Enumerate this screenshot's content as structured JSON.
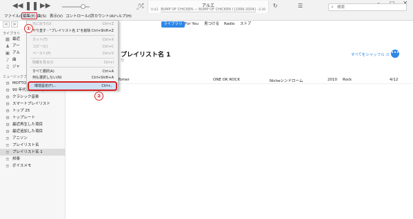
{
  "player": {
    "prev_icon": "rewind-icon",
    "pause_icon": "pause-icon",
    "next_icon": "fast-forward-icon",
    "shuffle_icon": "shuffle-icon",
    "repeat_icon": "repeat-icon"
  },
  "now_playing": {
    "title": "アルエ",
    "subtitle": "BUMP OF CHICKEN — BUMP OF CHICKEN I [1999-2004]",
    "elapsed": "0:43",
    "remaining": "-3:39"
  },
  "window_controls": {
    "list_icon": "list-icon",
    "minimize": "–",
    "maximize": "□",
    "close": "×"
  },
  "search": {
    "placeholder": "検索"
  },
  "menubar": {
    "items": [
      "ファイル(F)",
      "編集(E)",
      "曲(S)",
      "表示(V)",
      "コントロール(C)",
      "アカウント(A)",
      "ヘルプ(H)"
    ]
  },
  "nav": {
    "back": "<",
    "forward": ">",
    "tabs": [
      "ライブラリ",
      "For You",
      "見つける",
      "Radio",
      "ストア"
    ]
  },
  "sidebar": {
    "library_header": "ライブラリ",
    "library_items": [
      "最近",
      "アー",
      "アル",
      "曲",
      "ジャ"
    ],
    "playlists_header": "ミュージックプ",
    "playlists": [
      "MOTTO",
      "90 年代ミュージック",
      "クラシック音楽",
      "スマートプレイリスト",
      "トップ 25",
      "トップレート",
      "最近再生した項目",
      "最近追加した項目",
      "アニソン",
      "プレイリスト名",
      "プレイリスト名 1",
      "邦楽",
      "ボイスメモ"
    ],
    "selected": "プレイリスト名 1"
  },
  "main": {
    "playlist_title": "プレイリスト名 1",
    "playlist_sub": "分",
    "shuffle_label": "すべてをシャッフル",
    "more_label": "•••",
    "row": {
      "artist_tail": "Tomer",
      "artist": "ONE OK ROCK",
      "album": "Nicheシンドローム",
      "year": "2010",
      "genre": "Rock",
      "date": "4/12"
    }
  },
  "edit_menu": {
    "items": [
      {
        "label": "元に戻す(U)",
        "shortcut": "Ctrl+Z",
        "enabled": false
      },
      {
        "label": "やり直す - \"プレイリスト名 1\"を削除",
        "shortcut": "Ctrl+Shift+Z",
        "enabled": true
      },
      {
        "label": "カット(T)",
        "shortcut": "Ctrl+X",
        "enabled": false
      },
      {
        "label": "コピー(C)",
        "shortcut": "Ctrl+C",
        "enabled": false
      },
      {
        "label": "ペースト(P)",
        "shortcut": "Ctrl+V",
        "enabled": false
      },
      {
        "label": "情報を見る(I)",
        "shortcut": "Ctrl+I",
        "enabled": false
      },
      {
        "label": "すべて選択(A)",
        "shortcut": "Ctrl+A",
        "enabled": true
      },
      {
        "label": "何も選択しない(N)",
        "shortcut": "Ctrl+Shift+A",
        "enabled": true
      },
      {
        "label": "環境設定(F)...",
        "shortcut": "Ctrl+,",
        "enabled": true
      }
    ]
  },
  "annotations": {
    "step1": "①",
    "step2": "②",
    "color": "#d42121"
  }
}
